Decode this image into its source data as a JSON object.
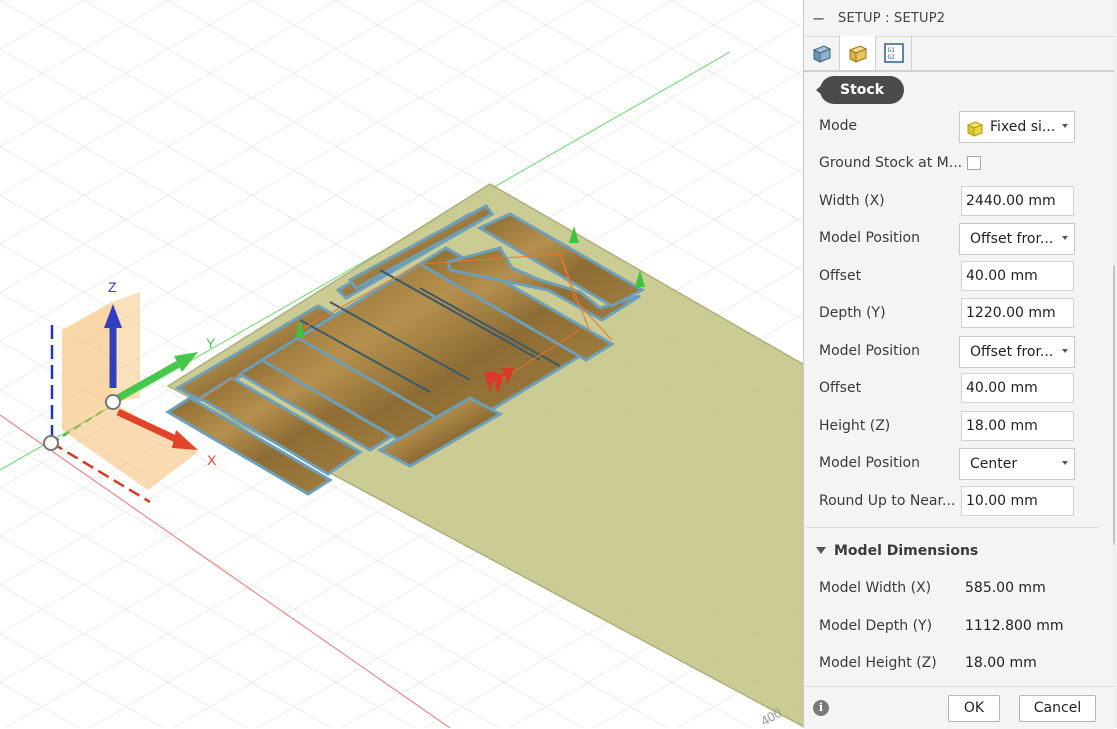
{
  "viewport": {
    "axis_labels": {
      "x": "X",
      "y": "Y",
      "z": "Z"
    },
    "ruler_label": "400",
    "colors": {
      "stock": "#c7c78c",
      "wood": "#a58040",
      "board_edge": "#6d9fb8",
      "axis_x": "#e0442a",
      "axis_y": "#45c74b",
      "axis_z": "#2f3fc0",
      "wcs_box": "#f5b35a"
    }
  },
  "panel": {
    "title": "SETUP : SETUP2",
    "collapse_label": "−",
    "tabs": [
      {
        "icon": "setup-tab-icon"
      },
      {
        "icon": "stock-tab-icon"
      },
      {
        "icon": "post-process-tab-icon",
        "text_top": "G1",
        "text_bottom": "G2"
      }
    ],
    "section_pill": "Stock",
    "fields": {
      "mode": {
        "label": "Mode",
        "value": "Fixed si..."
      },
      "ground_stock": {
        "label": "Ground Stock at M...",
        "checked": false
      },
      "width": {
        "label": "Width (X)",
        "value": "2440.00 mm"
      },
      "width_model_position": {
        "label": "Model Position",
        "value": "Offset fror..."
      },
      "width_offset": {
        "label": "Offset",
        "value": "40.00 mm"
      },
      "depth": {
        "label": "Depth (Y)",
        "value": "1220.00 mm"
      },
      "depth_model_position": {
        "label": "Model Position",
        "value": "Offset fror..."
      },
      "depth_offset": {
        "label": "Offset",
        "value": "40.00 mm"
      },
      "height": {
        "label": "Height (Z)",
        "value": "18.00 mm"
      },
      "height_model_position": {
        "label": "Model Position",
        "value": "Center"
      },
      "round_up": {
        "label": "Round Up to Near...",
        "value": "10.00 mm"
      }
    },
    "model_dimensions": {
      "title": "Model Dimensions",
      "width": {
        "label": "Model Width (X)",
        "value": "585.00 mm"
      },
      "depth": {
        "label": "Model Depth (Y)",
        "value": "1112.800 mm"
      },
      "height": {
        "label": "Model Height (Z)",
        "value": "18.00 mm"
      }
    },
    "footer": {
      "info": "i",
      "ok": "OK",
      "cancel": "Cancel"
    }
  }
}
